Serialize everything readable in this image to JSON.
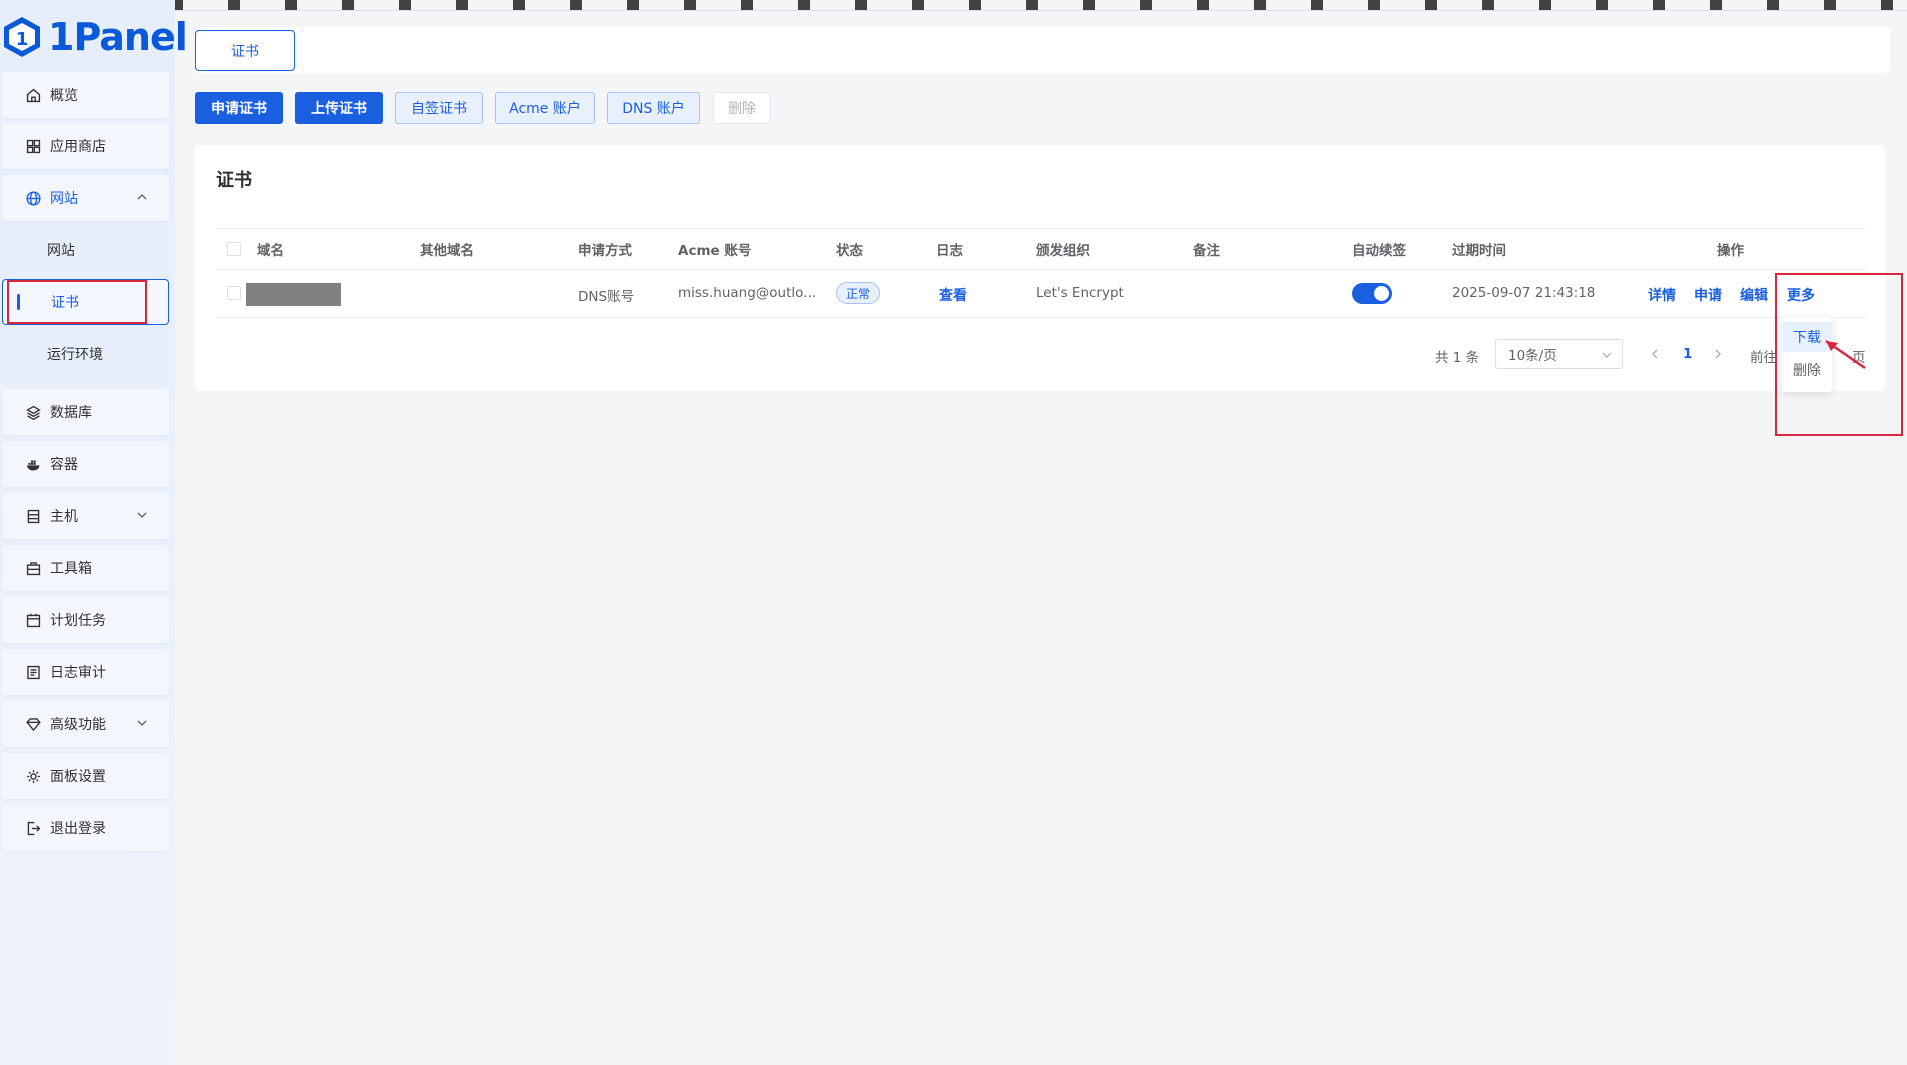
{
  "app": {
    "logo_text": "1Panel"
  },
  "sidebar": {
    "items": [
      {
        "label": "概览",
        "icon": "home-icon"
      },
      {
        "label": "应用商店",
        "icon": "grid-icon"
      },
      {
        "label": "网站",
        "icon": "globe-icon",
        "expanded": true
      },
      {
        "label": "数据库",
        "icon": "layers-icon"
      },
      {
        "label": "容器",
        "icon": "docker-icon"
      },
      {
        "label": "主机",
        "icon": "server-icon",
        "collapsed": true
      },
      {
        "label": "工具箱",
        "icon": "toolbox-icon"
      },
      {
        "label": "计划任务",
        "icon": "calendar-icon"
      },
      {
        "label": "日志审计",
        "icon": "log-icon"
      },
      {
        "label": "高级功能",
        "icon": "diamond-icon",
        "collapsed": true
      },
      {
        "label": "面板设置",
        "icon": "gear-icon"
      },
      {
        "label": "退出登录",
        "icon": "logout-icon"
      }
    ],
    "subitems": [
      {
        "label": "网站"
      },
      {
        "label": "证书",
        "active": true
      },
      {
        "label": "运行环境"
      }
    ]
  },
  "tabs": {
    "active": "证书"
  },
  "toolbar": {
    "apply_cert": "申请证书",
    "upload_cert": "上传证书",
    "self_signed": "自签证书",
    "acme_account": "Acme 账户",
    "dns_account": "DNS 账户",
    "delete": "删除"
  },
  "card": {
    "title": "证书",
    "columns": [
      "域名",
      "其他域名",
      "申请方式",
      "Acme 账号",
      "状态",
      "日志",
      "颁发组织",
      "备注",
      "自动续签",
      "过期时间",
      "操作"
    ],
    "rows": [
      {
        "domain": "",
        "other_domains": "",
        "method": "DNS账号",
        "acme_account": "miss.huang@outlo...",
        "status": "正常",
        "log": "查看",
        "issuer": "Let's Encrypt",
        "remark": "",
        "auto_renew": true,
        "expire": "2025-09-07 21:43:18",
        "actions": [
          "详情",
          "申请",
          "编辑",
          "更多"
        ]
      }
    ]
  },
  "pagination": {
    "total": "共 1 条",
    "page_size": "10条/页",
    "current": "1",
    "goto_prefix": "前往",
    "goto_suffix": "页"
  },
  "more_menu": {
    "items": [
      "下载",
      "删除"
    ],
    "hovered": "下载"
  },
  "colors": {
    "primary": "#1a5fe0",
    "annotation": "#d7263d"
  }
}
